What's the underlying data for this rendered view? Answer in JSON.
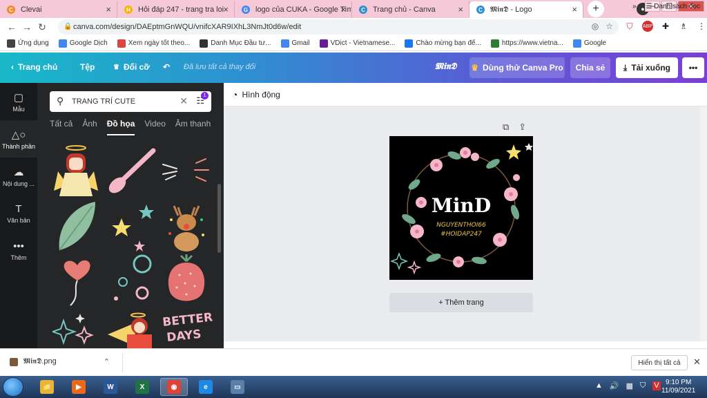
{
  "browser": {
    "tabs": [
      {
        "title": "Clevai",
        "favicon": "orange-circle-icon",
        "color": "#f28c28",
        "glyph": "C"
      },
      {
        "title": "Hỏi đáp 247 - trang tra loi",
        "favicon": "hoidap-icon",
        "color": "#f2b705",
        "glyph": "H"
      },
      {
        "title": "logo của CUKA - Google Tìm k",
        "favicon": "google-icon",
        "color": "#4285f4",
        "glyph": "G"
      },
      {
        "title": "Trang chủ - Canva",
        "favicon": "canva-icon",
        "color": "#2f8fd0",
        "glyph": "C"
      },
      {
        "title": "𝕸𝖎𝖓𝕯 - Logo",
        "favicon": "canva-icon",
        "color": "#2f8fd0",
        "glyph": "C"
      }
    ],
    "new_tab": "+",
    "url": "canva.com/design/DAEptmGnWQU/vnifcXAR9IXhL3NmJt0d6w/edit",
    "bookmarks": [
      {
        "label": "Ứng dụng",
        "icon": "apps-icon",
        "color": "#444"
      },
      {
        "label": "Google Dịch",
        "icon": "translate-icon",
        "color": "#4285f4"
      },
      {
        "label": "Xem ngày tốt theo...",
        "icon": "calendar-icon",
        "color": "#d44"
      },
      {
        "label": "Danh Mục Đầu tư...",
        "icon": "invest-icon",
        "color": "#333"
      },
      {
        "label": "Gmail",
        "icon": "google-icon",
        "color": "#4285f4"
      },
      {
        "label": "VDict - Vietnamese...",
        "icon": "vdict-icon",
        "color": "#6a1b9a"
      },
      {
        "label": "Chào mừng bạn đế...",
        "icon": "facebook-icon",
        "color": "#1877f2"
      },
      {
        "label": "https://www.vietna...",
        "icon": "globe-icon",
        "color": "#2e7d32"
      },
      {
        "label": "Google",
        "icon": "google-icon",
        "color": "#4285f4"
      }
    ],
    "bookmarks_more": "»",
    "reading_list": "Danh sách đọc"
  },
  "canva": {
    "header": {
      "home": "Trang chủ",
      "file": "Tệp",
      "resize": "Đổi cỡ",
      "saved": "Đã lưu tất cả thay đổi",
      "design_name": "𝕸𝖎𝖓𝕯",
      "try_pro": "Dùng thử Canva Pro",
      "share": "Chia sẻ",
      "download": "Tải xuống",
      "more": "•••"
    },
    "rail": [
      {
        "label": "Mẫu",
        "icon": "templates-icon",
        "glyph": "▢"
      },
      {
        "label": "Thành phần",
        "icon": "elements-icon",
        "glyph": "△○"
      },
      {
        "label": "Nội dung ...",
        "icon": "upload-icon",
        "glyph": "☁"
      },
      {
        "label": "Văn bản",
        "icon": "text-icon",
        "glyph": "T"
      },
      {
        "label": "Thêm",
        "icon": "more-icon",
        "glyph": "•••"
      }
    ],
    "search": {
      "value": "TRANG TRÍ CUTE",
      "filter_count": "1"
    },
    "panel_tabs": [
      "Tất cả",
      "Ảnh",
      "Đồ họa",
      "Video",
      "Âm thanh"
    ],
    "active_tab": "Đồ họa",
    "toolbar": {
      "animate": "Hình động"
    },
    "design": {
      "title": "MinD",
      "line1": "NGUYENTHOI66",
      "line2": "#HOIDAP247"
    },
    "add_page": "+ Thêm trang"
  },
  "downloads": {
    "file": "𝕸𝖎𝖓𝕯.png",
    "show_all": "Hiển thị tất cả"
  },
  "taskbar": {
    "apps": [
      {
        "name": "explorer",
        "color": "#e8b53a",
        "glyph": "📁"
      },
      {
        "name": "media-player",
        "color": "#e86a1a",
        "glyph": "▶"
      },
      {
        "name": "word",
        "color": "#2b579a",
        "glyph": "W"
      },
      {
        "name": "excel",
        "color": "#217346",
        "glyph": "X"
      },
      {
        "name": "chrome",
        "color": "#db4437",
        "glyph": "◉"
      },
      {
        "name": "internet-explorer",
        "color": "#1e88e5",
        "glyph": "e"
      },
      {
        "name": "remote",
        "color": "#5a7fa8",
        "glyph": "▭"
      }
    ],
    "time": "9:10 PM",
    "date": "11/09/2021"
  }
}
